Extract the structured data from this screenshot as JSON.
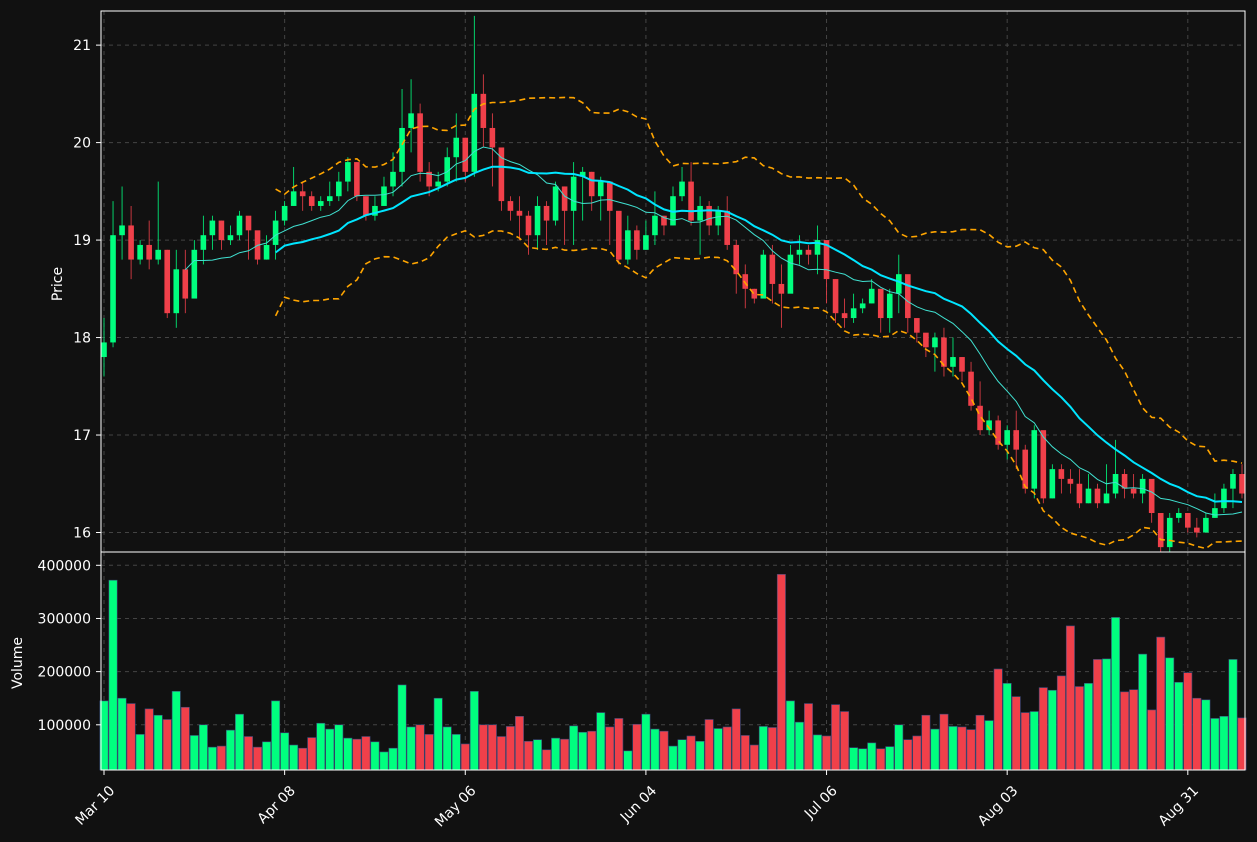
{
  "chart_data": {
    "type": "candlestick",
    "colors": {
      "background": "#111111",
      "up": "#00ff7f",
      "down": "#f0404a",
      "wick_up": "#00ff7f",
      "wick_down": "#f0404a",
      "ma_fast": "#40e0d0",
      "ma_slow": "#00e5ff",
      "bollinger": "#ffa500",
      "grid": "#444444",
      "axes": "#ffffff"
    },
    "price_axis": {
      "label": "Price",
      "range": [
        15.8,
        21.35
      ],
      "ticks": [
        16,
        17,
        18,
        19,
        20,
        21
      ]
    },
    "volume_axis": {
      "label": "Volume",
      "range": [
        15000,
        425000
      ],
      "ticks": [
        100000,
        200000,
        300000,
        400000
      ],
      "tick_labels": [
        "100000",
        "200000",
        "300000",
        "400000"
      ]
    },
    "x_axis": {
      "ticks": [
        {
          "index": 0,
          "label": "Mar 10"
        },
        {
          "index": 20,
          "label": "Apr 08"
        },
        {
          "index": 40,
          "label": "May 06"
        },
        {
          "index": 60,
          "label": "Jun 04"
        },
        {
          "index": 80,
          "label": "Jul 06"
        },
        {
          "index": 100,
          "label": "Aug 03"
        },
        {
          "index": 120,
          "label": "Aug 31"
        }
      ]
    },
    "grid": true,
    "start_price": 17.8,
    "closes": [
      17.95,
      19.05,
      19.15,
      18.8,
      18.95,
      18.8,
      18.9,
      18.25,
      18.7,
      18.4,
      18.9,
      19.05,
      19.2,
      19.0,
      19.05,
      19.25,
      19.1,
      18.8,
      18.95,
      19.2,
      19.35,
      19.5,
      19.45,
      19.35,
      19.4,
      19.45,
      19.6,
      19.8,
      19.45,
      19.25,
      19.35,
      19.55,
      19.7,
      20.15,
      20.3,
      19.7,
      19.55,
      19.6,
      19.85,
      20.05,
      19.7,
      20.5,
      20.15,
      19.95,
      19.4,
      19.3,
      19.25,
      19.05,
      19.35,
      19.2,
      19.55,
      19.3,
      19.65,
      19.7,
      19.45,
      19.6,
      19.3,
      18.8,
      19.1,
      18.9,
      19.05,
      19.25,
      19.15,
      19.45,
      19.6,
      19.2,
      19.35,
      19.15,
      19.3,
      18.95,
      18.65,
      18.5,
      18.4,
      18.85,
      18.55,
      18.45,
      18.85,
      18.9,
      18.85,
      19.0,
      18.6,
      18.25,
      18.2,
      18.3,
      18.35,
      18.5,
      18.2,
      18.45,
      18.65,
      18.2,
      18.05,
      17.9,
      18.0,
      17.7,
      17.8,
      17.65,
      17.3,
      17.05,
      17.15,
      16.9,
      17.05,
      16.85,
      16.45,
      17.05,
      16.35,
      16.65,
      16.55,
      16.5,
      16.3,
      16.45,
      16.3,
      16.4,
      16.6,
      16.45,
      16.4,
      16.55,
      16.2,
      15.85,
      16.15,
      16.2,
      16.05,
      16.0,
      16.15,
      16.25,
      16.45,
      16.6,
      16.4
    ],
    "highs": [
      18.2,
      19.4,
      19.55,
      19.35,
      19.0,
      19.2,
      19.6,
      18.9,
      18.9,
      18.9,
      19.0,
      19.25,
      19.25,
      19.2,
      19.15,
      19.3,
      19.2,
      19.0,
      19.05,
      19.3,
      19.4,
      19.75,
      19.6,
      19.5,
      19.45,
      19.6,
      19.7,
      19.85,
      19.8,
      19.45,
      19.45,
      19.65,
      19.9,
      20.55,
      20.65,
      20.4,
      19.8,
      19.7,
      19.95,
      20.3,
      20.05,
      21.3,
      20.7,
      20.3,
      19.65,
      19.45,
      19.45,
      19.3,
      19.45,
      19.4,
      19.6,
      19.55,
      19.8,
      19.75,
      19.7,
      19.65,
      19.6,
      19.1,
      19.25,
      19.15,
      19.2,
      19.5,
      19.25,
      19.55,
      19.75,
      19.8,
      19.45,
      19.4,
      19.35,
      19.45,
      19.0,
      18.75,
      18.5,
      18.9,
      18.95,
      18.75,
      18.95,
      19.05,
      18.95,
      19.15,
      18.85,
      18.6,
      18.4,
      18.45,
      18.4,
      18.6,
      18.5,
      18.5,
      18.85,
      18.55,
      18.15,
      18.0,
      18.05,
      18.1,
      18.0,
      17.8,
      17.75,
      17.55,
      17.25,
      17.2,
      17.1,
      17.25,
      16.9,
      17.1,
      16.85,
      16.7,
      16.7,
      16.65,
      16.65,
      16.6,
      16.5,
      16.7,
      16.95,
      16.65,
      16.6,
      16.6,
      16.5,
      16.2,
      16.2,
      16.25,
      16.2,
      16.15,
      16.2,
      16.4,
      16.5,
      16.65,
      16.7
    ],
    "lows": [
      17.6,
      17.9,
      18.8,
      18.6,
      18.75,
      18.7,
      18.75,
      18.2,
      18.1,
      18.25,
      18.65,
      18.75,
      18.9,
      18.9,
      18.95,
      19.0,
      18.8,
      18.75,
      18.8,
      18.8,
      19.15,
      19.35,
      19.3,
      19.3,
      19.3,
      19.35,
      19.4,
      19.5,
      19.4,
      19.2,
      19.2,
      19.35,
      19.45,
      19.55,
      19.9,
      19.6,
      19.45,
      19.5,
      19.55,
      19.6,
      19.6,
      19.65,
      19.95,
      19.55,
      19.3,
      19.2,
      19.0,
      18.85,
      18.9,
      18.95,
      19.15,
      18.95,
      18.95,
      19.2,
      19.3,
      19.2,
      18.95,
      18.75,
      18.75,
      18.8,
      18.9,
      18.95,
      19.05,
      19.15,
      19.4,
      19.15,
      18.85,
      19.05,
      19.05,
      18.9,
      18.45,
      18.3,
      18.35,
      18.45,
      18.35,
      18.1,
      18.5,
      18.75,
      18.75,
      18.65,
      18.35,
      18.15,
      18.1,
      18.15,
      18.25,
      18.35,
      18.05,
      18.05,
      18.25,
      18.05,
      17.95,
      17.8,
      17.65,
      17.6,
      17.6,
      17.55,
      17.25,
      17.0,
      17.0,
      16.85,
      16.75,
      16.65,
      16.4,
      16.35,
      16.3,
      16.35,
      16.4,
      16.4,
      16.25,
      16.3,
      16.25,
      16.3,
      16.35,
      16.35,
      16.35,
      16.3,
      16.1,
      15.8,
      15.8,
      16.1,
      16.0,
      15.95,
      16.05,
      16.15,
      16.2,
      16.25,
      16.35
    ],
    "volumes": [
      145000,
      372000,
      150000,
      140000,
      82000,
      130000,
      118000,
      110000,
      163000,
      133000,
      80000,
      100000,
      58000,
      60000,
      90000,
      120000,
      78000,
      58000,
      68000,
      145000,
      85000,
      62000,
      56000,
      76000,
      103000,
      92000,
      100000,
      75000,
      73000,
      78000,
      68000,
      49000,
      56000,
      175000,
      96000,
      100000,
      82000,
      150000,
      96000,
      82000,
      64000,
      163000,
      100000,
      100000,
      78000,
      97000,
      116000,
      69000,
      72000,
      53000,
      75000,
      73000,
      98000,
      86000,
      88000,
      123000,
      96000,
      112000,
      51000,
      101000,
      120000,
      92000,
      88000,
      60000,
      72000,
      79000,
      69000,
      110000,
      93000,
      96000,
      130000,
      80000,
      62000,
      97000,
      95000,
      383000,
      145000,
      105000,
      140000,
      81000,
      79000,
      138000,
      125000,
      57000,
      55000,
      66000,
      55000,
      59000,
      100000,
      72000,
      79000,
      118000,
      92000,
      120000,
      97000,
      96000,
      91000,
      118000,
      108000,
      205000,
      178000,
      153000,
      123000,
      125000,
      170000,
      165000,
      192000,
      286000,
      172000,
      178000,
      223000,
      224000,
      302000,
      162000,
      166000,
      233000,
      128000,
      265000,
      226000,
      180000,
      198000,
      150000,
      147000,
      112000,
      116000,
      223000,
      113000
    ],
    "series": [
      {
        "indicator": "moving_average",
        "window": 10,
        "color_key": "ma_fast",
        "style": "solid-thin"
      },
      {
        "indicator": "moving_average",
        "window": 20,
        "color_key": "ma_slow",
        "style": "solid"
      },
      {
        "indicator": "bollinger_bands",
        "window": 20,
        "std": 2,
        "color_key": "bollinger",
        "style": "dashed"
      }
    ]
  }
}
